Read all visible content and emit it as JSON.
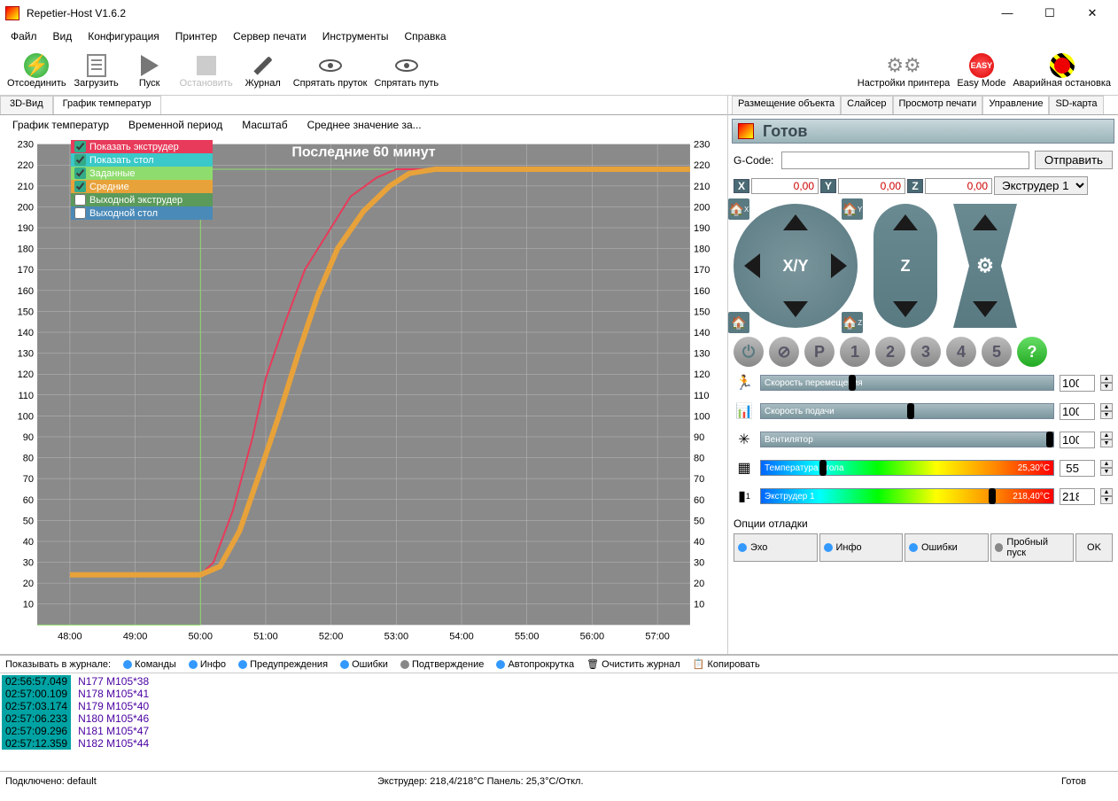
{
  "window": {
    "title": "Repetier-Host V1.6.2"
  },
  "menu": [
    "Файл",
    "Вид",
    "Конфигурация",
    "Принтер",
    "Сервер печати",
    "Инструменты",
    "Справка"
  ],
  "toolbar": {
    "disconnect": "Отсоединить",
    "load": "Загрузить",
    "start": "Пуск",
    "stop": "Остановить",
    "log": "Журнал",
    "hide_fil": "Спрятать пруток",
    "hide_path": "Спрятать путь",
    "printer_settings": "Настройки принтера",
    "easy": "Easy Mode",
    "estop": "Аварийная остановка"
  },
  "left_tabs": {
    "view3d": "3D-Вид",
    "tempgraph": "График температур"
  },
  "chart_menu": [
    "График температур",
    "Временной период",
    "Масштаб",
    "Среднее значение за..."
  ],
  "chart_title": "Последние 60 минут",
  "legend": {
    "show_extruder": "Показать экструдер",
    "show_bed": "Показать стол",
    "target": "Заданные",
    "avg": "Средние",
    "out_extruder": "Выходной экструдер",
    "out_bed": "Выходной стол"
  },
  "chart_data": {
    "type": "line",
    "title": "Последние 60 минут",
    "xlabel": "",
    "ylabel": "",
    "ylim": [
      0,
      230
    ],
    "x_ticks": [
      "48:00",
      "49:00",
      "50:00",
      "51:00",
      "52:00",
      "53:00",
      "54:00",
      "55:00",
      "56:00",
      "57:00"
    ],
    "y_ticks": [
      10,
      20,
      30,
      40,
      50,
      60,
      70,
      80,
      90,
      100,
      110,
      120,
      130,
      140,
      150,
      160,
      170,
      180,
      190,
      200,
      210,
      220,
      230
    ],
    "series": [
      {
        "name": "Показать экструдер",
        "color": "#e83a5a",
        "x": [
          48.0,
          48.5,
          49.0,
          49.5,
          50.0,
          50.2,
          50.5,
          50.8,
          51.0,
          51.3,
          51.6,
          52.0,
          52.3,
          52.7,
          53.0,
          53.5,
          54.0,
          55.0,
          56.0,
          57.0,
          57.5
        ],
        "y": [
          24,
          24,
          24,
          24,
          24,
          30,
          55,
          90,
          118,
          145,
          170,
          190,
          205,
          214,
          218,
          218,
          218,
          218,
          218,
          218,
          218
        ]
      },
      {
        "name": "Средние",
        "color": "#e8a23a",
        "x": [
          48.0,
          48.5,
          49.0,
          49.5,
          50.0,
          50.3,
          50.6,
          50.9,
          51.2,
          51.5,
          51.8,
          52.1,
          52.5,
          52.9,
          53.2,
          53.6,
          54.0,
          55.0,
          56.0,
          57.0,
          57.5
        ],
        "y": [
          24,
          24,
          24,
          24,
          24,
          28,
          45,
          72,
          100,
          130,
          158,
          180,
          198,
          210,
          216,
          218,
          218,
          218,
          218,
          218,
          218
        ]
      }
    ]
  },
  "right_tabs": {
    "placement": "Размещение объекта",
    "slicer": "Слайсер",
    "preview": "Просмотр печати",
    "control": "Управление",
    "sd": "SD-карта"
  },
  "status": "Готов",
  "gcode": {
    "label": "G-Code:",
    "value": "",
    "send": "Отправить"
  },
  "axes": {
    "X": "0,00",
    "Y": "0,00",
    "Z": "0,00",
    "extruder_sel": "Экструдер 1"
  },
  "jog": {
    "xy": "X/Y",
    "z": "Z"
  },
  "round_buttons": [
    "P",
    "1",
    "2",
    "3",
    "4",
    "5"
  ],
  "sliders": {
    "speed": {
      "label": "Скорость перемещения",
      "value": 100
    },
    "feed": {
      "label": "Скорость подачи",
      "value": 100
    },
    "fan": {
      "label": "Вентилятор",
      "value": 100
    },
    "bed": {
      "label": "Температура стола",
      "temp": "25,30°C",
      "value": 55
    },
    "extruder": {
      "label": "Экструдер 1",
      "temp": "218,40°C",
      "value": 218
    }
  },
  "extruder_num": "1",
  "debug": {
    "title": "Опции отладки",
    "echo": "Эхо",
    "info": "Инфо",
    "errors": "Ошибки",
    "dryrun": "Пробный пуск",
    "ok": "OK"
  },
  "log_toolbar": {
    "show": "Показывать в журнале:",
    "commands": "Команды",
    "info": "Инфо",
    "warnings": "Предупреждения",
    "errors": "Ошибки",
    "ack": "Подтверждение",
    "autoscroll": "Автопрокрутка",
    "clear": "Очистить журнал",
    "copy": "Копировать"
  },
  "log": [
    {
      "ts": "02:56:57.049",
      "cmd": "N177 M105*38"
    },
    {
      "ts": "02:57:00.109",
      "cmd": "N178 M105*41"
    },
    {
      "ts": "02:57:03.174",
      "cmd": "N179 M105*40"
    },
    {
      "ts": "02:57:06.233",
      "cmd": "N180 M105*46"
    },
    {
      "ts": "02:57:09.296",
      "cmd": "N181 M105*47"
    },
    {
      "ts": "02:57:12.359",
      "cmd": "N182 M105*44"
    }
  ],
  "statusbar": {
    "conn": "Подключено: default",
    "temps": "Экструдер: 218,4/218°C Панель: 25,3°C/Откл.",
    "ready": "Готов"
  }
}
